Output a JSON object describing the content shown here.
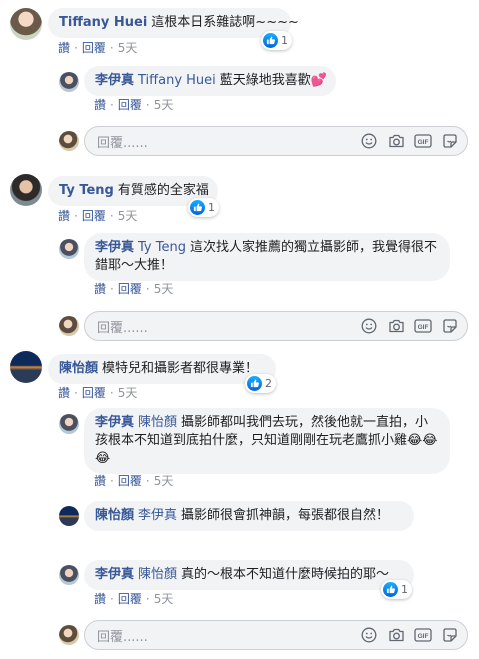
{
  "comments": [
    {
      "author": "Tiffany Huei",
      "text": "這根本日系雜誌啊~~~~",
      "reactions": "1",
      "actions": {
        "read": "讚",
        "reply": "回覆",
        "time": "5天"
      },
      "replies": [
        {
          "author": "李伊真",
          "mention": "Tiffany Huei",
          "text": "藍天綠地我喜歡💕",
          "actions": {
            "read": "讚",
            "reply": "回覆",
            "time": "5天"
          }
        }
      ],
      "reply_placeholder": "回覆......"
    },
    {
      "author": "Ty Teng",
      "text": "有質感的全家福",
      "reactions": "1",
      "actions": {
        "read": "讚",
        "reply": "回覆",
        "time": "5天"
      },
      "replies": [
        {
          "author": "李伊真",
          "mention": "Ty Teng",
          "text": "這次找人家推薦的獨立攝影師，我覺得很不錯耶～大推！",
          "actions": {
            "read": "讚",
            "reply": "回覆",
            "time": "5天"
          }
        }
      ],
      "reply_placeholder": "回覆......"
    },
    {
      "author": "陳怡顏",
      "text": "模特兒和攝影者都很專業！",
      "reactions": "2",
      "actions": {
        "read": "讚",
        "reply": "回覆",
        "time": "5天"
      },
      "replies": [
        {
          "author": "李伊真",
          "mention": "陳怡顏",
          "text": "攝影師都叫我們去玩，然後他就一直拍，小孩根本不知道到底拍什麼，只知道剛剛在玩老鷹抓小雞😂😂😂",
          "actions": {
            "read": "讚",
            "reply": "回覆",
            "time": "5天"
          }
        },
        {
          "author": "陳怡顏",
          "mention": "李伊真",
          "text": "攝影師很會抓神韻，每張都很自然！"
        },
        {
          "author": "李伊真",
          "mention": "陳怡顏",
          "text": "真的～根本不知道什麼時候拍的耶～",
          "reactions": "1",
          "actions": {
            "read": "讚",
            "reply": "回覆",
            "time": "5天"
          }
        }
      ],
      "reply_placeholder": "回覆......"
    }
  ],
  "icons": [
    "like-icon",
    "emoji-icon",
    "camera-icon",
    "gif-icon",
    "sticker-icon"
  ],
  "colors": {
    "link": "#385898",
    "bubble": "#f2f3f5",
    "muted": "#90949c",
    "like_blue": "#1877f2"
  }
}
